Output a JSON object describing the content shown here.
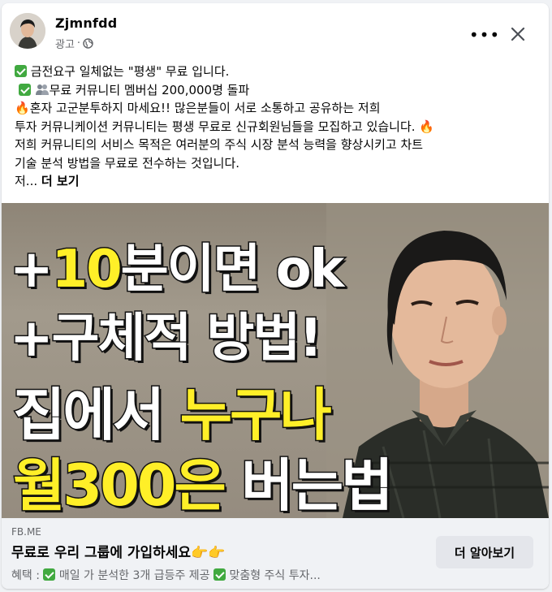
{
  "post": {
    "author": "Zjmnfdd",
    "sponsored_label": "광고",
    "meta_separator": " · ",
    "icons": {
      "avatar": "avatar-photo",
      "privacy": "globe-icon",
      "more": "more-options-icon",
      "close": "close-icon"
    },
    "more_label": "•••",
    "text_lines": [
      " 금전요구 일체없는 \"평생\" 무료 입니다.",
      "무료 커뮤니티 멤버십 200,000명 돌파",
      "혼자 고군분투하지 마세요!! 많은분들이 서로 소통하고 공유하는 저희",
      "투자 커뮤니케이션 커뮤니티는 평생 무료로 신규회원님들을 모집하고 있습니다. ",
      " 저희 커뮤니티의 서비스 목적은 여러분의 주식 시장 분석 능력을 향상시키고 차트",
      "기술 분석 방법을 무료로 전수하는 것입니다.",
      " 저..."
    ],
    "see_more": "더 보기"
  },
  "image": {
    "headline_1_prefix": "+",
    "headline_1_yellow": "10",
    "headline_1_rest": "분이면 ok",
    "headline_2": "+구체적 방법!",
    "headline_3_white": "집에서 ",
    "headline_3_yellow": "누구나",
    "headline_4_yellow": "월300은",
    "headline_4_white": " 버는법"
  },
  "link": {
    "domain": "FB.ME",
    "title": "무료로 우리 그룹에 가입하세요",
    "description_prefix": "혜택 : ",
    "description_1": " 매일 가 분석한 3개 급등주 제공 ",
    "description_2": " 맞춤형 주식 투자...",
    "cta_label": "더 알아보기"
  },
  "colors": {
    "check": "#41a940",
    "headline_yellow": "#ffef28",
    "link_bg": "#f0f2f5",
    "button_bg": "#e4e6eb"
  }
}
